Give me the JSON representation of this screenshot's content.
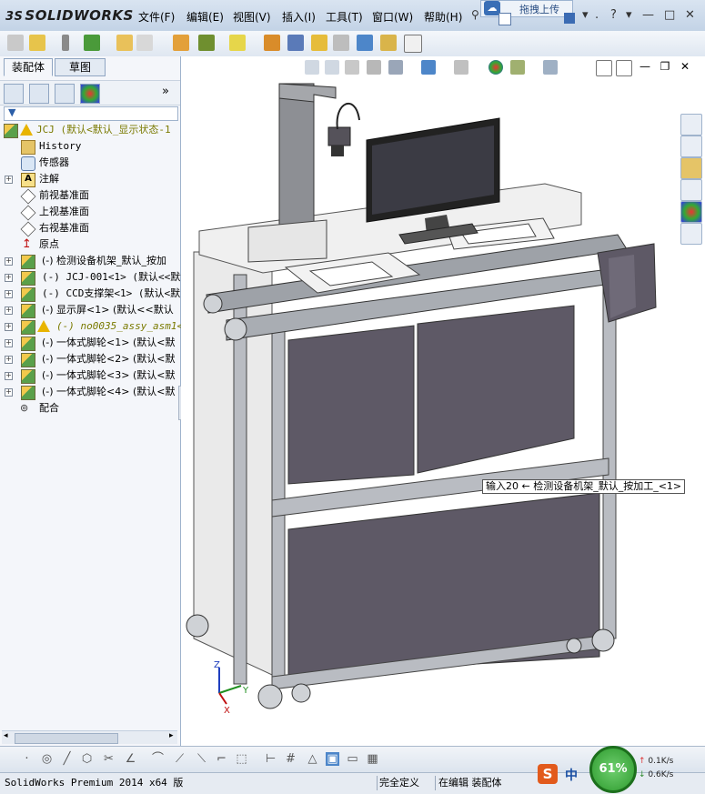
{
  "app": {
    "logo_prefix": "3S",
    "logo_name": "SOLIDWORKS"
  },
  "menu": [
    {
      "label": "文件(F)"
    },
    {
      "label": "编辑(E)"
    },
    {
      "label": "视图(V)"
    },
    {
      "label": "插入(I)"
    },
    {
      "label": "工具(T)"
    },
    {
      "label": "窗口(W)"
    },
    {
      "label": "帮助(H)"
    }
  ],
  "upload_button": {
    "label": "拖拽上传",
    "icon": "cloud-upload-icon"
  },
  "window_controls": {
    "help": "?",
    "minimize": "—",
    "restore": "□",
    "close": "✕"
  },
  "panel_tabs": [
    {
      "label": "装配体",
      "active": true
    },
    {
      "label": "草图",
      "active": false
    }
  ],
  "feature_tree": {
    "root": "JCJ  (默认<默认_显示状态-1",
    "items": [
      {
        "label": "History",
        "icon": "history-icon",
        "expand": false,
        "mono": true
      },
      {
        "label": "传感器",
        "icon": "sensor-icon",
        "expand": false
      },
      {
        "label": "注解",
        "icon": "annotation-icon",
        "expand": true
      },
      {
        "label": "前视基准面",
        "icon": "plane-icon",
        "expand": false
      },
      {
        "label": "上视基准面",
        "icon": "plane-icon",
        "expand": false
      },
      {
        "label": "右视基准面",
        "icon": "plane-icon",
        "expand": false
      },
      {
        "label": "原点",
        "icon": "origin-icon",
        "expand": false
      },
      {
        "label": "(-) 检测设备机架_默认_按加",
        "icon": "assembly-icon",
        "expand": true
      },
      {
        "label": "(-) JCJ-001<1> (默认<<默认",
        "icon": "assembly-icon",
        "expand": true
      },
      {
        "label": "(-) CCD支撑架<1> (默认<默",
        "icon": "assembly-icon",
        "expand": true
      },
      {
        "label": "(-) 显示屏<1> (默认<<默认",
        "icon": "assembly-icon",
        "expand": true
      },
      {
        "label": "(-) no0035_assy_asm1<1>",
        "icon": "assembly-warning-icon",
        "expand": true,
        "italic": true
      },
      {
        "label": "(-) 一体式脚轮<1> (默认<默",
        "icon": "assembly-icon",
        "expand": true
      },
      {
        "label": "(-) 一体式脚轮<2> (默认<默",
        "icon": "assembly-icon",
        "expand": true
      },
      {
        "label": "(-) 一体式脚轮<3> (默认<默",
        "icon": "assembly-icon",
        "expand": true
      },
      {
        "label": "(-) 一体式脚轮<4> (默认<默",
        "icon": "assembly-icon",
        "expand": true
      },
      {
        "label": "配合",
        "icon": "mates-icon",
        "expand": false
      }
    ]
  },
  "tooltip": "输入20 ← 检测设备机架_默认_按加工_<1>",
  "triad": {
    "x": "X",
    "y": "Y",
    "z": "Z"
  },
  "statusbar": {
    "product": "SolidWorks Premium 2014 x64 版",
    "definition": "完全定义",
    "mode": "在编辑 装配体"
  },
  "speed_widget": {
    "percent": "61%",
    "up_rate": "0.1K/s",
    "down_rate": "0.6K/s"
  },
  "ime": {
    "logo": "S",
    "lang": "中"
  },
  "colors": {
    "accent": "#2d9a2d",
    "brand": "#c8102e",
    "machine_panel": "#5e5966",
    "frame": "#b9bcc2"
  }
}
